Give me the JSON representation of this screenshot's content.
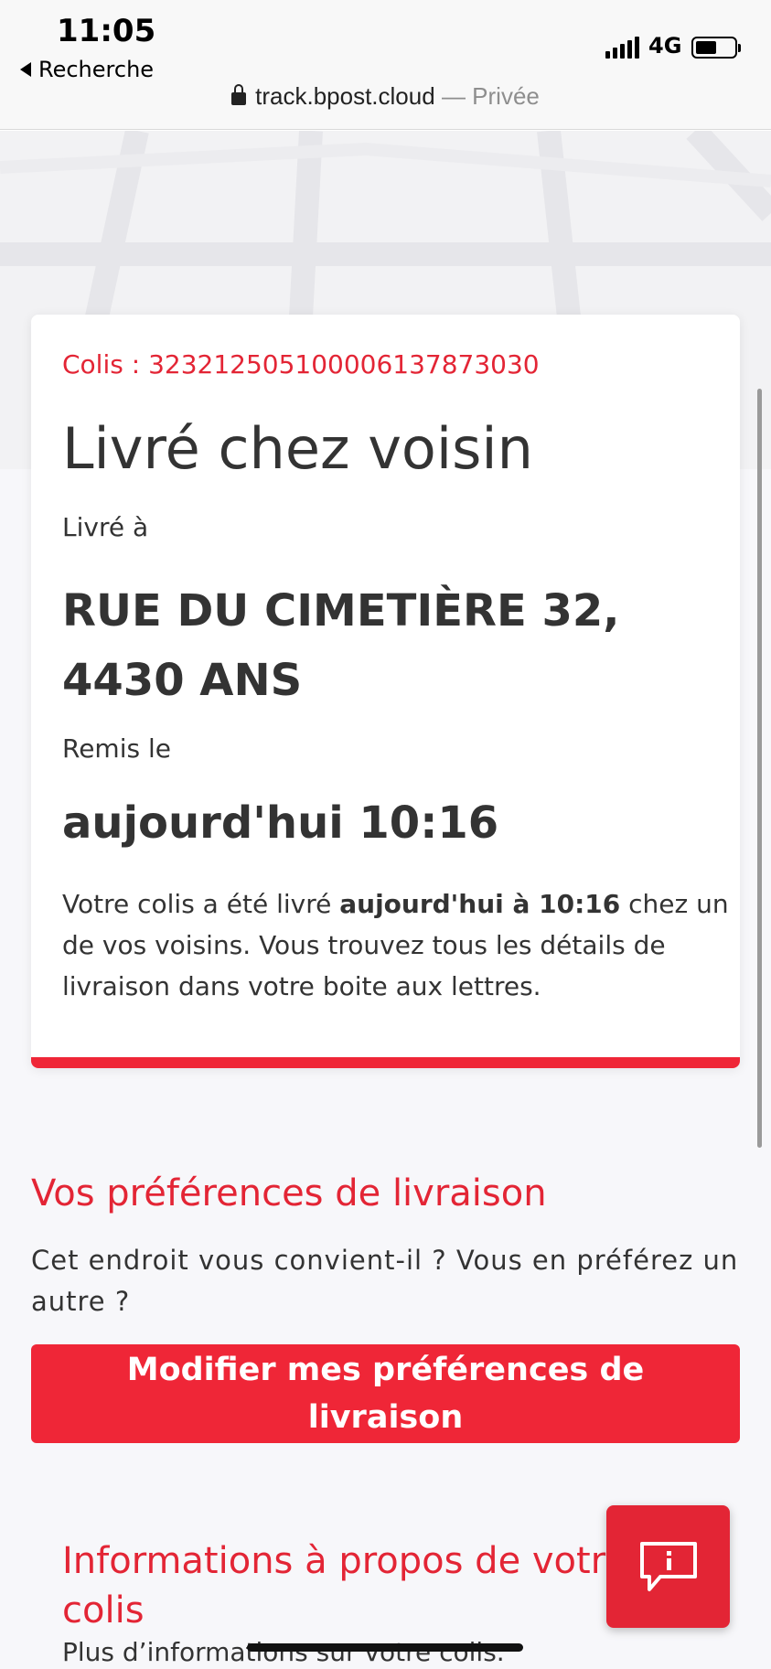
{
  "status_bar": {
    "time": "11:05",
    "back_label": "Recherche",
    "network": "4G"
  },
  "address_bar": {
    "domain": "track.bpost.cloud",
    "privacy": "— Privée"
  },
  "shipment": {
    "parcel_label": "Colis : 323212505100006137873030",
    "status": "Livré chez voisin",
    "delivered_at_label": "Livré à",
    "address": "RUE DU CIMETIÈRE 32, 4430 ANS",
    "handed_label": "Remis le",
    "handed_time": "aujourd'hui 10:16",
    "description": {
      "prefix": "Votre colis a été livré ",
      "emphasis": "aujourd'hui à 10:16",
      "suffix": " chez un de vos voisins. Vous trouvez tous les détails de livraison dans votre boite aux lettres."
    }
  },
  "preferences": {
    "title": "Vos préférences de livraison",
    "question": "Cet endroit vous convient-il ? Vous en préférez un autre ?",
    "button_label": "Modifier mes préférences de livraison"
  },
  "info": {
    "title": "Informations à propos de votre colis",
    "subtitle": "Plus d’informations sur votre colis."
  },
  "colors": {
    "brand_red": "#ef2637",
    "text": "#333333"
  },
  "icons": {
    "back": "back-triangle-icon",
    "lock": "lock-icon",
    "feedback": "info-chat-bubble-icon"
  }
}
